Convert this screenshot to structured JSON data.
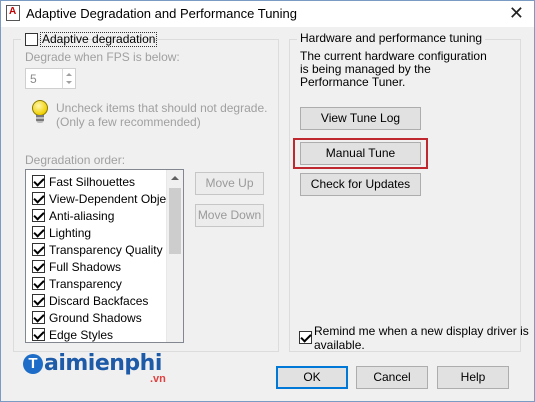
{
  "window": {
    "title": "Adaptive Degradation and Performance Tuning"
  },
  "left": {
    "adaptive_label": "Adaptive degradation",
    "adaptive_checked": false,
    "fps_label": "Degrade when FPS is below:",
    "fps_value": "5",
    "hint_line1": "Uncheck items that should not degrade.",
    "hint_line2": "(Only a few recommended)",
    "order_label": "Degradation order:",
    "items": [
      {
        "label": "Fast Silhouettes",
        "checked": true
      },
      {
        "label": "View-Dependent Objects",
        "checked": true
      },
      {
        "label": "Anti-aliasing",
        "checked": true
      },
      {
        "label": "Lighting",
        "checked": true
      },
      {
        "label": "Transparency Quality",
        "checked": true
      },
      {
        "label": "Full Shadows",
        "checked": true
      },
      {
        "label": "Transparency",
        "checked": true
      },
      {
        "label": "Discard Backfaces",
        "checked": true
      },
      {
        "label": "Ground Shadows",
        "checked": true
      },
      {
        "label": "Edge Styles",
        "checked": true
      }
    ],
    "move_up": "Move Up",
    "move_down": "Move Down"
  },
  "right": {
    "group_title": "Hardware and performance tuning",
    "desc_line1": "The current hardware configuration",
    "desc_line2": "is being managed by the",
    "desc_line3": "Performance Tuner.",
    "view_log": "View Tune Log",
    "manual_tune": "Manual Tune",
    "check_updates": "Check for Updates",
    "remind_line1": "Remind me when a new display driver is",
    "remind_line2": "available.",
    "remind_checked": true
  },
  "footer": {
    "ok": "OK",
    "cancel": "Cancel",
    "help": "Help"
  },
  "watermark": {
    "initial": "T",
    "word": "aimienphi",
    "tld": ".vn"
  },
  "colors": {
    "highlight": "#c0282f",
    "brand": "#1d5aa8"
  }
}
